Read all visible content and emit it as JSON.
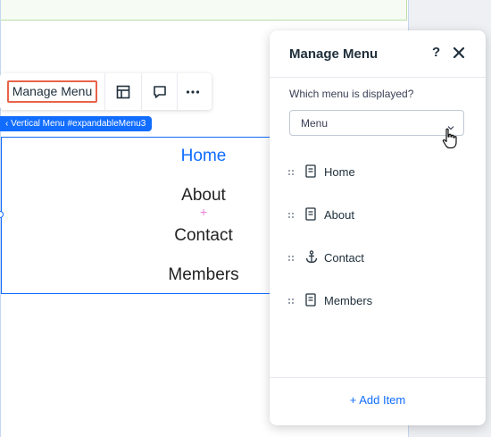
{
  "toolbar": {
    "manage_menu_label": "Manage Menu",
    "icons": [
      "layout-icon",
      "comment-icon",
      "more-icon"
    ]
  },
  "element_tag": {
    "label": "Vertical Menu #expandableMenu3"
  },
  "menu": {
    "items": [
      {
        "label": "Home",
        "color": "#116dff"
      },
      {
        "label": "About",
        "color": "#222222"
      },
      {
        "label": "Contact",
        "color": "#222222"
      },
      {
        "label": "Members",
        "color": "#222222"
      }
    ]
  },
  "panel": {
    "title": "Manage Menu",
    "help_label": "?",
    "which_menu_label": "Which menu is displayed?",
    "selected_menu": "Menu",
    "items": [
      {
        "label": "Home",
        "icon": "page-icon"
      },
      {
        "label": "About",
        "icon": "page-icon"
      },
      {
        "label": "Contact",
        "icon": "anchor-icon"
      },
      {
        "label": "Members",
        "icon": "page-icon"
      }
    ],
    "add_item_label": "+ Add Item"
  },
  "colors": {
    "accent": "#116dff",
    "highlight": "#e8634a",
    "text": "#20303c"
  }
}
